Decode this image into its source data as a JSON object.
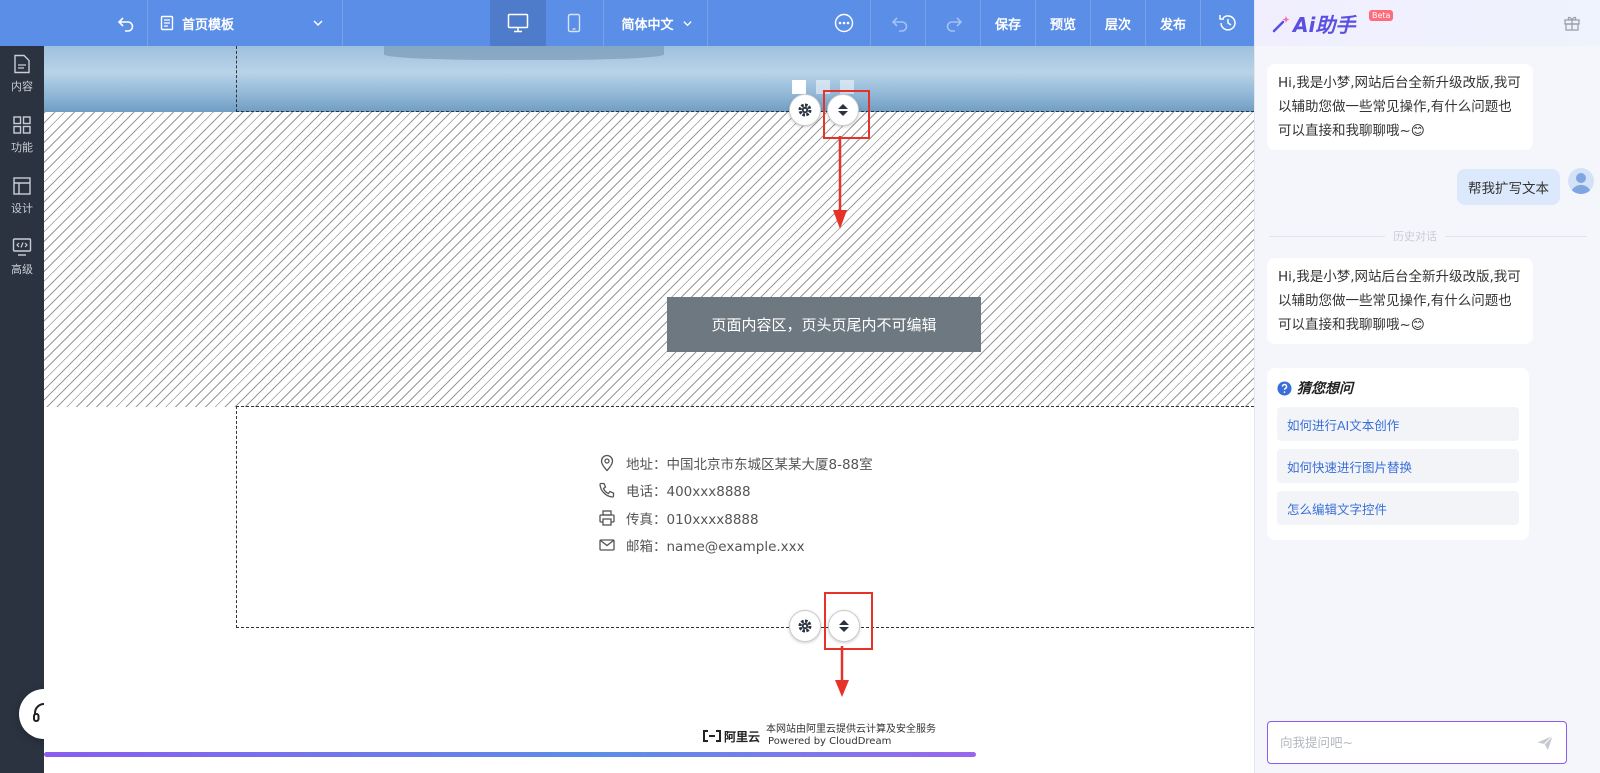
{
  "toolbar": {
    "page_select": "首页模板",
    "language": "简体中文",
    "save": "保存",
    "preview": "预览",
    "layers": "层次",
    "publish": "发布"
  },
  "sidebar": {
    "items": [
      {
        "label": "内容",
        "icon": "document-icon"
      },
      {
        "label": "功能",
        "icon": "grid-icon"
      },
      {
        "label": "设计",
        "icon": "layout-icon"
      },
      {
        "label": "高级",
        "icon": "code-monitor-icon"
      }
    ]
  },
  "canvas": {
    "content_area_label": "页面内容区，页头页尾内不可编辑",
    "contact": {
      "address": "地址：中国北京市东城区某某大厦8-88室",
      "phone": "电话：400xxx8888",
      "fax": "传真：010xxxx8888",
      "email": "邮箱：name@example.xxx"
    },
    "powered": {
      "logo": "阿里云",
      "line1": "本网站由阿里云提供云计算及安全服务",
      "line2": "Powered by CloudDream"
    },
    "progress_percent": 77
  },
  "ai": {
    "title": "Ai助手",
    "badge": "Beta",
    "greeting1": "Hi,我是小梦,网站后台全新升级改版,我可以辅助您做一些常见操作,有什么问题也可以直接和我聊聊哦~😊",
    "user_message": "帮我扩写文本",
    "history_divider": "历史对话",
    "greeting2": "Hi,我是小梦,网站后台全新升级改版,我可以辅助您做一些常见操作,有什么问题也可以直接和我聊聊哦~😊",
    "guess_title": "猜您想问",
    "guess_items": [
      "如何进行AI文本创作",
      "如何快速进行图片替换",
      "怎么编辑文字控件"
    ],
    "input_placeholder": "向我提问吧~"
  },
  "colors": {
    "toolbar": "#5b8ee6",
    "sidebar": "#2b3340",
    "highlight": "#e5332a",
    "accent": "#8a5cf0"
  }
}
